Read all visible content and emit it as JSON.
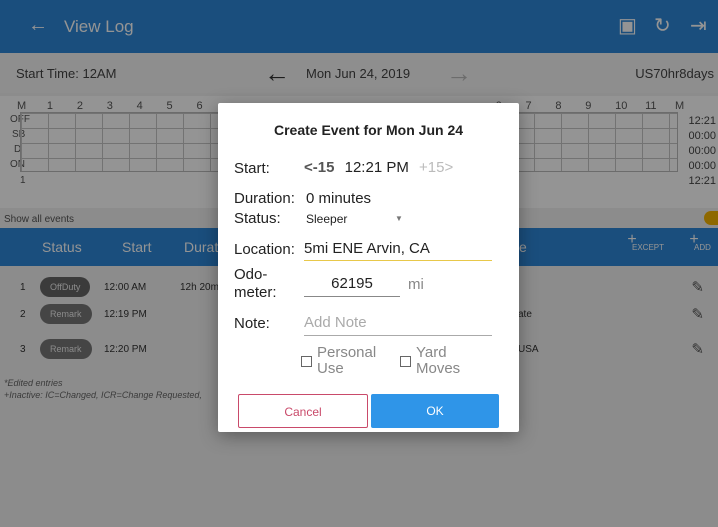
{
  "appbar": {
    "title": "View Log"
  },
  "datebar": {
    "start_time": "Start Time: 12AM",
    "date": "Mon Jun 24, 2019",
    "ruleset": "US70hr8days"
  },
  "grid": {
    "hours": [
      "M",
      "1",
      "2",
      "3",
      "4",
      "5",
      "6",
      "",
      "",
      "",
      "",
      "",
      "",
      "",
      "",
      "",
      "6",
      "7",
      "8",
      "9",
      "10",
      "11",
      "M"
    ],
    "rows": [
      "OFF",
      "SB",
      "D",
      "ON"
    ],
    "totals": [
      "12:21",
      "00:00",
      "00:00",
      "00:00",
      "12:21"
    ],
    "bottom_num": "1",
    "show_all": "Show all events"
  },
  "table": {
    "headers": [
      "Status",
      "Start",
      "Durat",
      "e"
    ],
    "except": "EXCEPT",
    "add": "ADD",
    "rows": [
      {
        "idx": "1",
        "status": "OffDuty",
        "time": "12:00 AM",
        "dur": "12h 20m",
        "loc": ""
      },
      {
        "idx": "2",
        "status": "Remark",
        "time": "12:19 PM",
        "dur": "",
        "loc": "ate"
      },
      {
        "idx": "3",
        "status": "Remark",
        "time": "12:20 PM",
        "dur": "",
        "loc": "USA"
      }
    ],
    "foot1": "*Edited entries",
    "foot2": "+Inactive: IC=Changed, ICR=Change Requested,"
  },
  "dialog": {
    "title": "Create Event for Mon Jun 24",
    "start_label": "Start:",
    "minus": "<-15",
    "start_value": "12:21 PM",
    "plus": "+15>",
    "duration_label": "Duration:",
    "duration_value": "0 minutes",
    "status_label": "Status:",
    "status_value": "Sleeper",
    "location_label": "Location:",
    "location_value": "5mi ENE Arvin, CA",
    "odo_label_1": "Odo-",
    "odo_label_2": "meter:",
    "odo_value": "62195",
    "odo_unit": "mi",
    "note_label": "Note:",
    "note_placeholder": "Add Note",
    "personal_1": "Personal",
    "personal_2": "Use",
    "yard_1": "Yard",
    "yard_2": "Moves",
    "cancel": "Cancel",
    "ok": "OK"
  }
}
